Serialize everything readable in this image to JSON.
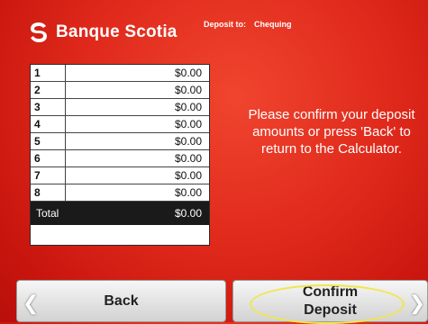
{
  "header": {
    "brand": "Banque Scotia",
    "logo_icon": "scotia-logo-icon",
    "deposit_to_label": "Deposit to:",
    "deposit_to_value": "Chequing"
  },
  "table": {
    "rows": [
      {
        "num": "1",
        "amount": "$0.00"
      },
      {
        "num": "2",
        "amount": "$0.00"
      },
      {
        "num": "3",
        "amount": "$0.00"
      },
      {
        "num": "4",
        "amount": "$0.00"
      },
      {
        "num": "5",
        "amount": "$0.00"
      },
      {
        "num": "6",
        "amount": "$0.00"
      },
      {
        "num": "7",
        "amount": "$0.00"
      },
      {
        "num": "8",
        "amount": "$0.00"
      }
    ],
    "total_label": "Total",
    "total_value": "$0.00"
  },
  "message": "Please confirm your deposit amounts or press 'Back' to return to the Calculator.",
  "buttons": {
    "back_label": "Back",
    "confirm_line1": "Confirm",
    "confirm_line2": "Deposit",
    "back_icon": "chevron-left-icon",
    "confirm_icon": "chevron-right-icon"
  },
  "colors": {
    "background": "#e02a1c",
    "highlight": "#f2e64a"
  }
}
